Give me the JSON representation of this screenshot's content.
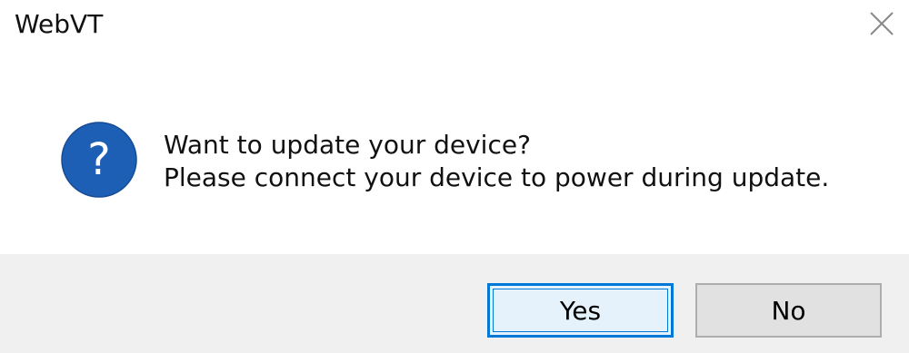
{
  "window": {
    "title": "WebVT"
  },
  "icons": {
    "close": "close-icon",
    "question": "question-icon"
  },
  "message": {
    "line1": "Want to update your device?",
    "line2": "Please connect your device to power during update."
  },
  "buttons": {
    "yes_label": "Yes",
    "no_label": "No"
  },
  "colors": {
    "accent": "#0078d7",
    "icon_blue": "#1d5fb5",
    "button_bar": "#f0f0f0"
  }
}
